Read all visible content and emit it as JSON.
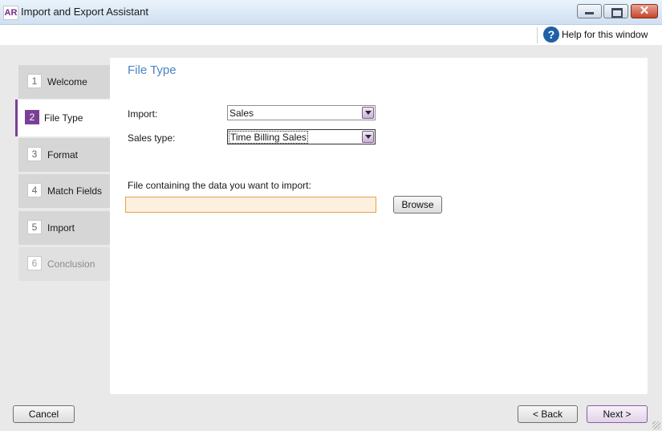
{
  "window": {
    "app_badge": "AR",
    "title": "Import and Export Assistant"
  },
  "help": {
    "icon": "?",
    "label": "Help for this window"
  },
  "steps": [
    {
      "num": "1",
      "label": "Welcome",
      "state": "normal"
    },
    {
      "num": "2",
      "label": "File Type",
      "state": "active"
    },
    {
      "num": "3",
      "label": "Format",
      "state": "normal"
    },
    {
      "num": "4",
      "label": "Match Fields",
      "state": "normal"
    },
    {
      "num": "5",
      "label": "Import",
      "state": "normal"
    },
    {
      "num": "6",
      "label": "Conclusion",
      "state": "disabled"
    }
  ],
  "main": {
    "section_title": "File Type",
    "import_label": "Import:",
    "import_value": "Sales",
    "sales_type_label": "Sales type:",
    "sales_type_value": "Time Billing Sales",
    "file_label": "File containing the data you want to import:",
    "file_value": "",
    "browse_label": "Browse"
  },
  "footer": {
    "cancel_label": "Cancel",
    "back_label": "< Back",
    "next_label": "Next >"
  },
  "colors": {
    "accent": "#7b3f98",
    "section_title": "#4b84bf",
    "file_input_bg": "#fdf0df",
    "file_input_border": "#e5a24a"
  }
}
